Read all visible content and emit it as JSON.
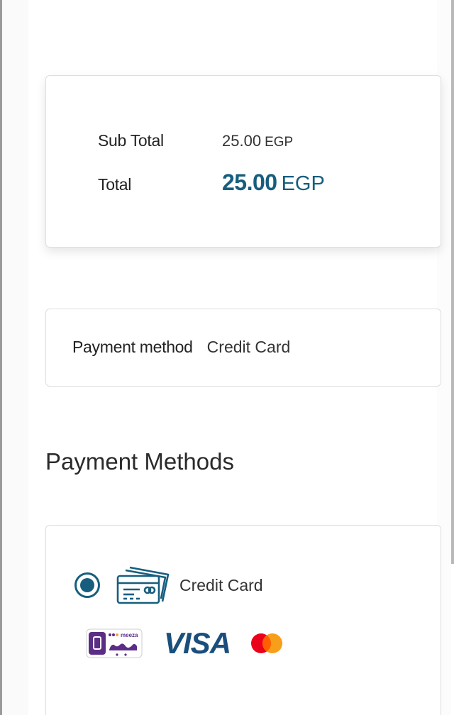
{
  "summary": {
    "subtotal_label": "Sub Total",
    "subtotal_amount": "25.00",
    "subtotal_currency": "EGP",
    "total_label": "Total",
    "total_amount": "25.00",
    "total_currency": "EGP"
  },
  "payment_method": {
    "label": "Payment method",
    "value": "Credit Card"
  },
  "payment_methods": {
    "title": "Payment Methods",
    "options": [
      {
        "label": "Credit Card",
        "selected": true,
        "icon": "credit-card-icon",
        "brands": [
          "meeza-logo",
          "visa-logo",
          "mastercard-logo"
        ]
      }
    ],
    "visa_text": "VISA",
    "meeza_text": "meeza"
  },
  "colors": {
    "accent": "#175e7e",
    "visa": "#1a4f7d",
    "meeza": "#5b2d86",
    "mastercard_red": "#eb001b",
    "mastercard_orange": "#f79e1b"
  }
}
